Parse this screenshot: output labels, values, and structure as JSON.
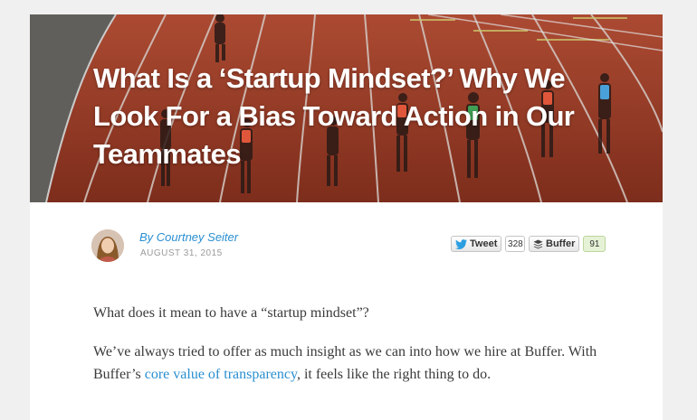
{
  "article": {
    "title": "What Is a ‘Startup Mindset?’ Why We Look For a Bias Toward Action in Our Teammates",
    "author": "By Courtney Seiter",
    "date": "AUGUST 31, 2015"
  },
  "share": {
    "tweet_label": "Tweet",
    "tweet_count": "328",
    "buffer_label": "Buffer",
    "buffer_count": "91"
  },
  "body": {
    "p1": "What does it mean to have a “startup mindset”?",
    "p2_before": "We’ve always tried to offer as much insight as we can into how we hire at Buffer. With Buffer’s ",
    "p2_link": "core value of transparency",
    "p2_after": ", it feels like the right thing to do."
  },
  "colors": {
    "link": "#2a8fd0",
    "track": "#b2452b",
    "buffer_count_bg": "#e6f2d6"
  },
  "icons": {
    "tweet": "twitter-bird-icon",
    "buffer": "buffer-stack-icon"
  }
}
